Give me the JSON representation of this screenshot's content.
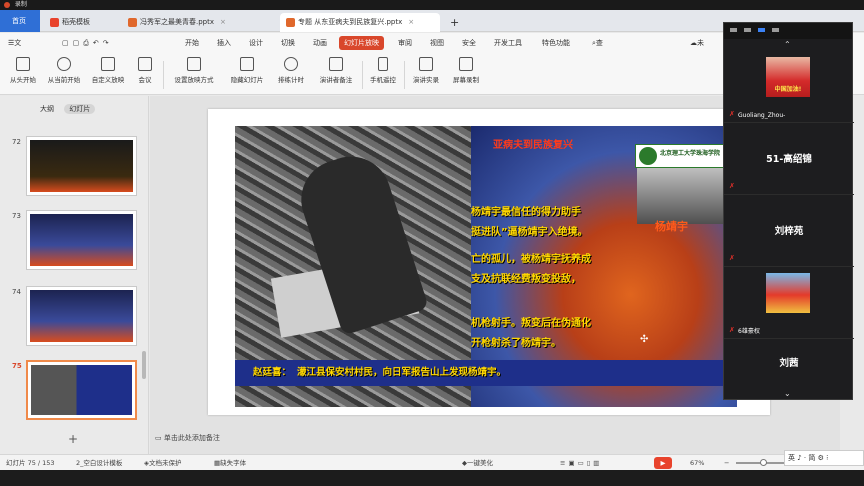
{
  "window": {
    "title": "录制"
  },
  "tabs": [
    {
      "label": "首页",
      "kind": "home"
    },
    {
      "label": "稻壳模板",
      "kind": "docer",
      "color": "#e8432c"
    },
    {
      "label": "冯秀军之最美青春.pptx",
      "kind": "ppt",
      "color": "#e0682c"
    },
    {
      "label": "专题 从东亚病夫到民族复兴.pptx",
      "kind": "ppt",
      "color": "#e0682c",
      "active": true
    }
  ],
  "menubar": {
    "file": "文件",
    "items": [
      "开始",
      "插入",
      "设计",
      "切换",
      "动画",
      "幻灯片放映",
      "审阅",
      "视图",
      "安全",
      "开发工具",
      "特色功能"
    ],
    "selected": "幻灯片放映",
    "search": "查找",
    "cloud": "未同步"
  },
  "ribbon": {
    "buttons": [
      "从头开始",
      "从当前开始",
      "自定义放映",
      "会议",
      "设置放映方式",
      "隐藏幻灯片",
      "排练计时",
      "演讲者备注",
      "手机遥控",
      "演讲实录",
      "屏幕录制"
    ]
  },
  "sidebar": {
    "tabs": [
      "大纲",
      "幻灯片"
    ],
    "active_tab": "幻灯片",
    "thumbnails": [
      {
        "num": "72"
      },
      {
        "num": "73"
      },
      {
        "num": "74"
      },
      {
        "num": "75",
        "selected": true
      }
    ]
  },
  "slide": {
    "title": "亚病夫到民族复兴",
    "logo_text": "北京理工大学珠海学院",
    "portrait_name": "杨靖宇",
    "lines": [
      "杨靖宇最信任的得力助手",
      "挺进队”逼杨靖宇入绝境。",
      "亡的孤儿，被杨靖宇抚养成",
      "支及抗联经费叛变投敌，",
      "机枪射手。叛变后在伪通化",
      "开枪射杀了杨靖宇。"
    ],
    "caption_name": "赵廷喜：",
    "caption_text": "濛江县保安村村民，向日军报告山上发现杨靖宇。"
  },
  "notes": {
    "placeholder": "单击此处添加备注"
  },
  "status": {
    "slide_counter": "幻灯片 75 / 153",
    "template": "2_空白设计模板",
    "protect": "文档未保护",
    "font": "缺失字体",
    "beautify": "一键美化",
    "zoom": "67%"
  },
  "ime": {
    "text": "英 ♪ · 简 ⚙ ⁝"
  },
  "meeting": {
    "participants": [
      {
        "name": "Guoliang_Zhou-",
        "kind": "avatar-red",
        "avatar_text": "中国加油!"
      },
      {
        "name": "51-高绍锦",
        "kind": "name"
      },
      {
        "name": "刘梓苑",
        "kind": "name"
      },
      {
        "name": "6雄豪权",
        "kind": "avatar-dragon"
      },
      {
        "name": "刘茜",
        "kind": "name"
      }
    ]
  }
}
